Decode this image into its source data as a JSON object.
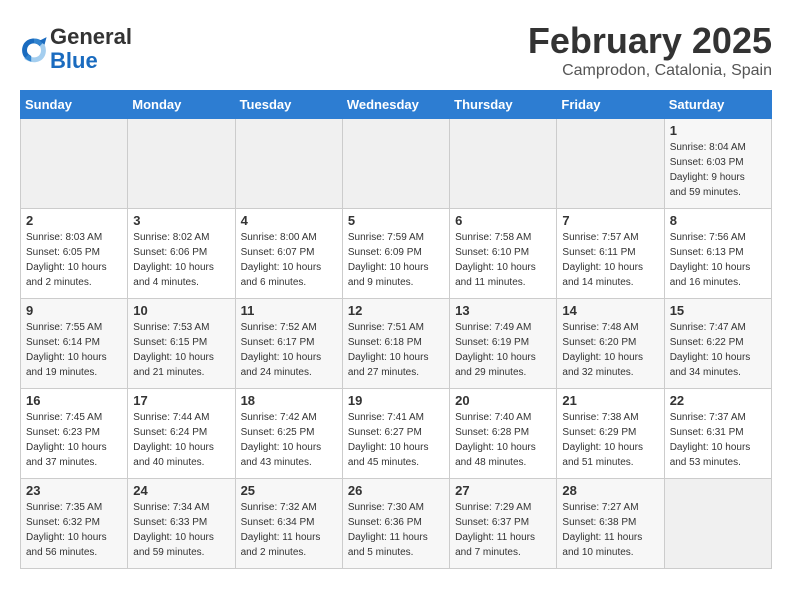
{
  "header": {
    "logo_text_general": "General",
    "logo_text_blue": "Blue",
    "title": "February 2025",
    "subtitle": "Camprodon, Catalonia, Spain"
  },
  "days_of_week": [
    "Sunday",
    "Monday",
    "Tuesday",
    "Wednesday",
    "Thursday",
    "Friday",
    "Saturday"
  ],
  "weeks": [
    [
      {
        "day": "",
        "info": ""
      },
      {
        "day": "",
        "info": ""
      },
      {
        "day": "",
        "info": ""
      },
      {
        "day": "",
        "info": ""
      },
      {
        "day": "",
        "info": ""
      },
      {
        "day": "",
        "info": ""
      },
      {
        "day": "1",
        "info": "Sunrise: 8:04 AM\nSunset: 6:03 PM\nDaylight: 9 hours\nand 59 minutes."
      }
    ],
    [
      {
        "day": "2",
        "info": "Sunrise: 8:03 AM\nSunset: 6:05 PM\nDaylight: 10 hours\nand 2 minutes."
      },
      {
        "day": "3",
        "info": "Sunrise: 8:02 AM\nSunset: 6:06 PM\nDaylight: 10 hours\nand 4 minutes."
      },
      {
        "day": "4",
        "info": "Sunrise: 8:00 AM\nSunset: 6:07 PM\nDaylight: 10 hours\nand 6 minutes."
      },
      {
        "day": "5",
        "info": "Sunrise: 7:59 AM\nSunset: 6:09 PM\nDaylight: 10 hours\nand 9 minutes."
      },
      {
        "day": "6",
        "info": "Sunrise: 7:58 AM\nSunset: 6:10 PM\nDaylight: 10 hours\nand 11 minutes."
      },
      {
        "day": "7",
        "info": "Sunrise: 7:57 AM\nSunset: 6:11 PM\nDaylight: 10 hours\nand 14 minutes."
      },
      {
        "day": "8",
        "info": "Sunrise: 7:56 AM\nSunset: 6:13 PM\nDaylight: 10 hours\nand 16 minutes."
      }
    ],
    [
      {
        "day": "9",
        "info": "Sunrise: 7:55 AM\nSunset: 6:14 PM\nDaylight: 10 hours\nand 19 minutes."
      },
      {
        "day": "10",
        "info": "Sunrise: 7:53 AM\nSunset: 6:15 PM\nDaylight: 10 hours\nand 21 minutes."
      },
      {
        "day": "11",
        "info": "Sunrise: 7:52 AM\nSunset: 6:17 PM\nDaylight: 10 hours\nand 24 minutes."
      },
      {
        "day": "12",
        "info": "Sunrise: 7:51 AM\nSunset: 6:18 PM\nDaylight: 10 hours\nand 27 minutes."
      },
      {
        "day": "13",
        "info": "Sunrise: 7:49 AM\nSunset: 6:19 PM\nDaylight: 10 hours\nand 29 minutes."
      },
      {
        "day": "14",
        "info": "Sunrise: 7:48 AM\nSunset: 6:20 PM\nDaylight: 10 hours\nand 32 minutes."
      },
      {
        "day": "15",
        "info": "Sunrise: 7:47 AM\nSunset: 6:22 PM\nDaylight: 10 hours\nand 34 minutes."
      }
    ],
    [
      {
        "day": "16",
        "info": "Sunrise: 7:45 AM\nSunset: 6:23 PM\nDaylight: 10 hours\nand 37 minutes."
      },
      {
        "day": "17",
        "info": "Sunrise: 7:44 AM\nSunset: 6:24 PM\nDaylight: 10 hours\nand 40 minutes."
      },
      {
        "day": "18",
        "info": "Sunrise: 7:42 AM\nSunset: 6:25 PM\nDaylight: 10 hours\nand 43 minutes."
      },
      {
        "day": "19",
        "info": "Sunrise: 7:41 AM\nSunset: 6:27 PM\nDaylight: 10 hours\nand 45 minutes."
      },
      {
        "day": "20",
        "info": "Sunrise: 7:40 AM\nSunset: 6:28 PM\nDaylight: 10 hours\nand 48 minutes."
      },
      {
        "day": "21",
        "info": "Sunrise: 7:38 AM\nSunset: 6:29 PM\nDaylight: 10 hours\nand 51 minutes."
      },
      {
        "day": "22",
        "info": "Sunrise: 7:37 AM\nSunset: 6:31 PM\nDaylight: 10 hours\nand 53 minutes."
      }
    ],
    [
      {
        "day": "23",
        "info": "Sunrise: 7:35 AM\nSunset: 6:32 PM\nDaylight: 10 hours\nand 56 minutes."
      },
      {
        "day": "24",
        "info": "Sunrise: 7:34 AM\nSunset: 6:33 PM\nDaylight: 10 hours\nand 59 minutes."
      },
      {
        "day": "25",
        "info": "Sunrise: 7:32 AM\nSunset: 6:34 PM\nDaylight: 11 hours\nand 2 minutes."
      },
      {
        "day": "26",
        "info": "Sunrise: 7:30 AM\nSunset: 6:36 PM\nDaylight: 11 hours\nand 5 minutes."
      },
      {
        "day": "27",
        "info": "Sunrise: 7:29 AM\nSunset: 6:37 PM\nDaylight: 11 hours\nand 7 minutes."
      },
      {
        "day": "28",
        "info": "Sunrise: 7:27 AM\nSunset: 6:38 PM\nDaylight: 11 hours\nand 10 minutes."
      },
      {
        "day": "",
        "info": ""
      }
    ]
  ]
}
